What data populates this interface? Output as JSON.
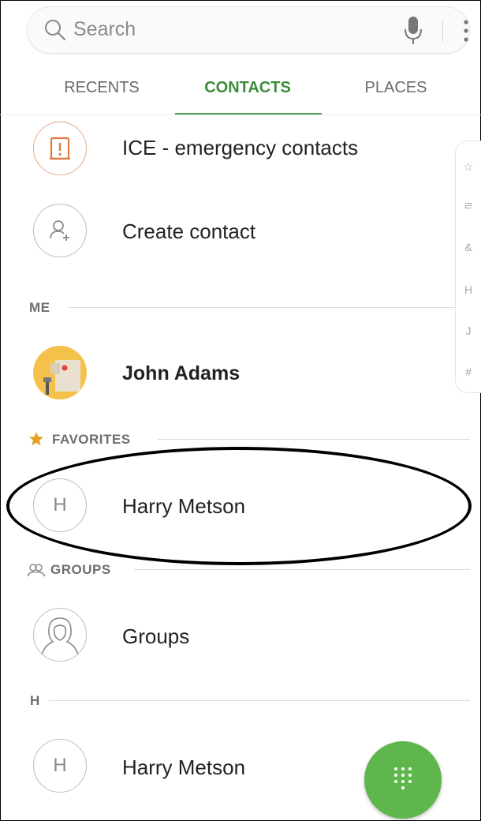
{
  "search": {
    "placeholder": "Search"
  },
  "tabs": {
    "recents": "RECENTS",
    "contacts": "CONTACTS",
    "places": "PLACES"
  },
  "rows": {
    "ice": "ICE - emergency contacts",
    "create": "Create contact",
    "me_name": "John Adams",
    "favorite_name": "Harry Metson",
    "favorite_initial": "H",
    "groups_name": "Groups",
    "h_name": "Harry Metson",
    "h_initial": "H"
  },
  "sections": {
    "me": "ME",
    "favorites": "FAVORITES",
    "groups": "GROUPS",
    "h": "H"
  },
  "index_letters": [
    "☆",
    "ㄹ",
    "&",
    "H",
    "J",
    "#"
  ],
  "colors": {
    "accent": "#3e8b3e",
    "fab": "#5fb64c",
    "star": "#e8a020",
    "ice": "#e07a3a"
  }
}
